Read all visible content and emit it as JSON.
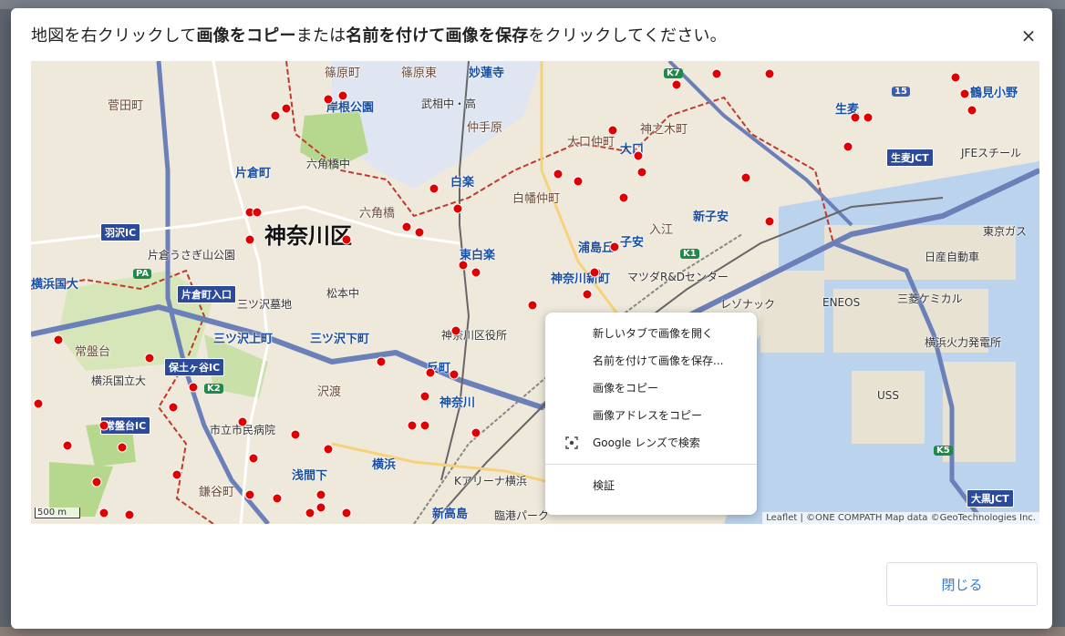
{
  "dialog": {
    "instruction_parts": [
      {
        "text": "地図を右クリックして",
        "bold": false
      },
      {
        "text": "画像をコピー",
        "bold": true
      },
      {
        "text": "または",
        "bold": false
      },
      {
        "text": "名前を付けて画像を保存",
        "bold": true
      },
      {
        "text": "をクリックしてください。",
        "bold": false
      }
    ],
    "close_icon": "×",
    "close_button_label": "閉じる"
  },
  "map": {
    "district_label": "神奈川区",
    "labels": [
      {
        "text": "篠原町",
        "kind": "town"
      },
      {
        "text": "篠原東",
        "kind": "town"
      },
      {
        "text": "妙蓮寺",
        "kind": "station"
      },
      {
        "text": "菅田町",
        "kind": "town"
      },
      {
        "text": "岸根公園",
        "kind": "station"
      },
      {
        "text": "武相中・高",
        "kind": "normal"
      },
      {
        "text": "仲手原",
        "kind": "town"
      },
      {
        "text": "神之木町",
        "kind": "town"
      },
      {
        "text": "大口仲町",
        "kind": "town"
      },
      {
        "text": "大口",
        "kind": "station"
      },
      {
        "text": "片倉町",
        "kind": "station"
      },
      {
        "text": "六角橋中",
        "kind": "normal"
      },
      {
        "text": "白楽",
        "kind": "station"
      },
      {
        "text": "白幡仲町",
        "kind": "town"
      },
      {
        "text": "六角橋",
        "kind": "town"
      },
      {
        "text": "新子安",
        "kind": "station"
      },
      {
        "text": "東白楽",
        "kind": "station"
      },
      {
        "text": "子安",
        "kind": "station"
      },
      {
        "text": "神奈川新町",
        "kind": "station"
      },
      {
        "text": "三ツ沢上町",
        "kind": "station"
      },
      {
        "text": "三ツ沢下町",
        "kind": "station"
      },
      {
        "text": "神奈川区役所",
        "kind": "normal"
      },
      {
        "text": "常盤台",
        "kind": "town"
      },
      {
        "text": "横浜国立大",
        "kind": "normal"
      },
      {
        "text": "沢渡",
        "kind": "town"
      },
      {
        "text": "反町",
        "kind": "station"
      },
      {
        "text": "神奈川",
        "kind": "station"
      },
      {
        "text": "横浜",
        "kind": "station"
      },
      {
        "text": "新高島",
        "kind": "station"
      },
      {
        "text": "鶴見小野",
        "kind": "station"
      },
      {
        "text": "生麦",
        "kind": "station"
      },
      {
        "text": "東京ガス",
        "kind": "normal"
      },
      {
        "text": "日産自動車",
        "kind": "normal"
      },
      {
        "text": "三菱ケミカル",
        "kind": "normal"
      },
      {
        "text": "横浜火力発電所",
        "kind": "normal"
      },
      {
        "text": "ENEOS",
        "kind": "normal"
      },
      {
        "text": "レゾナック",
        "kind": "normal"
      },
      {
        "text": "USS",
        "kind": "normal"
      },
      {
        "text": "JFEスチール",
        "kind": "normal"
      },
      {
        "text": "鎌谷町",
        "kind": "town"
      },
      {
        "text": "市立市民病院",
        "kind": "normal"
      },
      {
        "text": "片倉うさぎ山公園",
        "kind": "normal"
      },
      {
        "text": "三ツ沢墓地",
        "kind": "normal"
      },
      {
        "text": "松本中",
        "kind": "normal"
      },
      {
        "text": "浦島丘",
        "kind": "station"
      },
      {
        "text": "マツダR&Dセンター",
        "kind": "normal"
      },
      {
        "text": "入江",
        "kind": "town"
      },
      {
        "text": "Kアリーナ横浜",
        "kind": "normal"
      },
      {
        "text": "臨港パーク",
        "kind": "normal"
      },
      {
        "text": "浅間下",
        "kind": "station"
      },
      {
        "text": "横浜国大",
        "kind": "station"
      }
    ],
    "ic_badges": [
      "羽沢IC",
      "保土ヶ谷IC",
      "常盤台IC",
      "生麦JCT",
      "大黒JCT",
      "片倉町入口"
    ],
    "road_badges": [
      "K7",
      "K1",
      "K2",
      "K5",
      "15",
      "PA"
    ],
    "scale": "500 m",
    "attribution": "Leaflet | ©ONE COMPATH Map data ©GeoTechnologies Inc.",
    "colors": {
      "marker": "#e00000",
      "land": "#efe9dc",
      "water": "#bcd3ee",
      "green": "#b5d88e",
      "expressway": "#6b7fb8"
    }
  },
  "context_menu": {
    "items": [
      {
        "label": "新しいタブで画像を開く",
        "icon": ""
      },
      {
        "label": "名前を付けて画像を保存...",
        "icon": ""
      },
      {
        "label": "画像をコピー",
        "icon": ""
      },
      {
        "label": "画像アドレスをコピー",
        "icon": ""
      },
      {
        "label": "Google レンズで検索",
        "icon": "lens-icon"
      }
    ],
    "footer_item": {
      "label": "検証"
    }
  }
}
